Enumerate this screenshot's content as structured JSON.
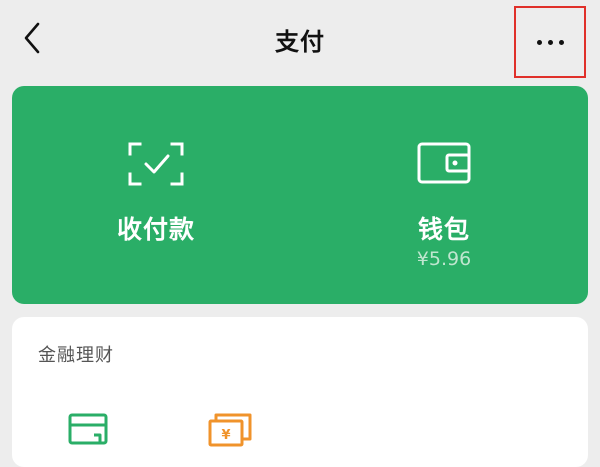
{
  "header": {
    "title": "支付",
    "back_icon": "chevron-left-icon",
    "more_icon": "more-dots-icon",
    "highlight_color": "#e0302a"
  },
  "payment_card": {
    "color": "#2aae67",
    "items": [
      {
        "label": "收付款",
        "icon": "scan-check-icon"
      },
      {
        "label": "钱包",
        "sub": "¥5.96",
        "icon": "wallet-icon"
      }
    ]
  },
  "finance": {
    "title": "金融理财",
    "icons": [
      {
        "icon": "credit-card-icon",
        "color": "#2aae67"
      },
      {
        "icon": "yuan-bills-icon",
        "color": "#f0932b",
        "glyph": "¥"
      }
    ]
  }
}
